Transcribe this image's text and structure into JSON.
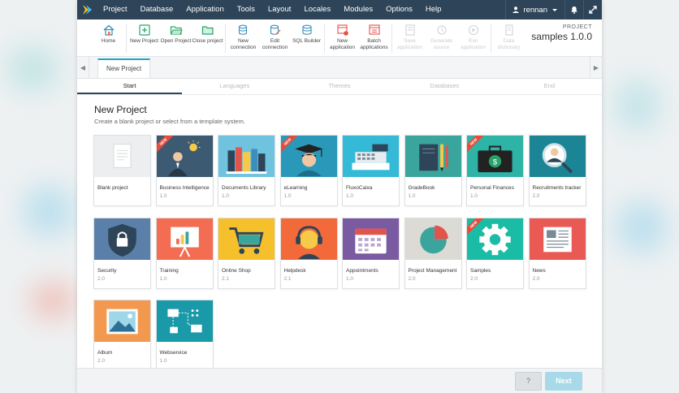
{
  "menu": {
    "items": [
      "Project",
      "Database",
      "Application",
      "Tools",
      "Layout",
      "Locales",
      "Modules",
      "Options",
      "Help"
    ],
    "user": "rennan"
  },
  "toolbar": {
    "buttons": [
      {
        "label": "Home",
        "icon": "home-icon"
      },
      {
        "label": "New Project",
        "icon": "plus-icon"
      },
      {
        "label": "Open Project",
        "icon": "folder-open-icon"
      },
      {
        "label": "Close project",
        "icon": "folder-close-icon"
      },
      {
        "label": "New connection",
        "icon": "database-plus-icon"
      },
      {
        "label": "Edit connection",
        "icon": "database-edit-icon"
      },
      {
        "label": "SQL Builder",
        "icon": "sql-icon"
      },
      {
        "label": "New application",
        "icon": "app-new-icon"
      },
      {
        "label": "Batch applications",
        "icon": "batch-icon"
      },
      {
        "label": "Save application",
        "icon": "save-icon"
      },
      {
        "label": "Generate source",
        "icon": "generate-icon"
      },
      {
        "label": "Run application",
        "icon": "run-icon"
      },
      {
        "label": "Data dictionary",
        "icon": "dictionary-icon"
      }
    ],
    "project_label": "PROJECT",
    "project_name": "samples 1.0.0"
  },
  "tabs": {
    "active": "New Project"
  },
  "steps": [
    "Start",
    "Languages",
    "Themes",
    "Databases",
    "End"
  ],
  "page": {
    "title": "New Project",
    "subtitle": "Create a blank project or select from a template system."
  },
  "ribbon_text": "NEW",
  "cards": [
    {
      "name": "Blank project",
      "version": "",
      "color": "#eceeef",
      "icon": "blank-document-icon",
      "new": false
    },
    {
      "name": "Business Intelligence",
      "version": "1.0",
      "color": "#3d5a73",
      "icon": "business-person-icon",
      "new": true
    },
    {
      "name": "Documents Library",
      "version": "1.0",
      "color": "#6fc3df",
      "icon": "books-icon",
      "new": false
    },
    {
      "name": "eLearning",
      "version": "1.0",
      "color": "#2a98b9",
      "icon": "graduate-icon",
      "new": true
    },
    {
      "name": "FluxoCaixa",
      "version": "1.0",
      "color": "#34bad6",
      "icon": "cash-register-icon",
      "new": false
    },
    {
      "name": "GradeBook",
      "version": "1.0",
      "color": "#3aa59c",
      "icon": "gradebook-icon",
      "new": false
    },
    {
      "name": "Personal Finances",
      "version": "1.0",
      "color": "#2eb4a6",
      "icon": "briefcase-money-icon",
      "new": true
    },
    {
      "name": "Recruitments tracker",
      "version": "2.0",
      "color": "#1c8595",
      "icon": "recruit-search-icon",
      "new": false
    },
    {
      "name": "Security",
      "version": "2.0",
      "color": "#5a7fa8",
      "icon": "shield-lock-icon",
      "new": false
    },
    {
      "name": "Training",
      "version": "1.0",
      "color": "#f26d52",
      "icon": "presentation-icon",
      "new": false
    },
    {
      "name": "Online Shop",
      "version": "2.1",
      "color": "#f5c02c",
      "icon": "shopping-cart-icon",
      "new": false
    },
    {
      "name": "Helpdesk",
      "version": "2.1",
      "color": "#f26a3a",
      "icon": "headset-icon",
      "new": false
    },
    {
      "name": "Appointments",
      "version": "1.0",
      "color": "#7a5aa0",
      "icon": "calendar-icon",
      "new": false
    },
    {
      "name": "Project Management",
      "version": "2.0",
      "color": "#dcdad5",
      "icon": "pie-chart-icon",
      "new": false
    },
    {
      "name": "Samples",
      "version": "2.0",
      "color": "#1abca5",
      "icon": "gear-icon",
      "new": true
    },
    {
      "name": "News",
      "version": "2.0",
      "color": "#e95a55",
      "icon": "newspaper-icon",
      "new": false
    },
    {
      "name": "Album",
      "version": "2.0",
      "color": "#f3994f",
      "icon": "picture-icon",
      "new": false
    },
    {
      "name": "Webservice",
      "version": "1.0",
      "color": "#1a99a8",
      "icon": "network-icon",
      "new": false
    }
  ],
  "footer": {
    "help_label": "?",
    "next_label": "Next"
  }
}
